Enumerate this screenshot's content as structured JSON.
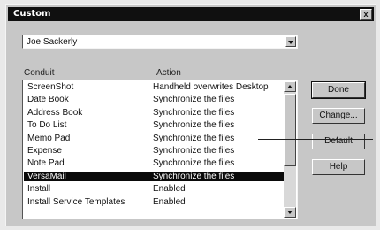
{
  "window": {
    "title": "Custom",
    "close_label": "x"
  },
  "user_select": {
    "value": "Joe Sackerly"
  },
  "columns": {
    "conduit": "Conduit",
    "action": "Action"
  },
  "list": {
    "rows": [
      {
        "conduit": "ScreenShot",
        "action": "Handheld overwrites Desktop"
      },
      {
        "conduit": "Date Book",
        "action": "Synchronize the files"
      },
      {
        "conduit": "Address Book",
        "action": "Synchronize the files"
      },
      {
        "conduit": "To Do List",
        "action": "Synchronize the files"
      },
      {
        "conduit": "Memo Pad",
        "action": "Synchronize the files"
      },
      {
        "conduit": "Expense",
        "action": "Synchronize the files"
      },
      {
        "conduit": "Note Pad",
        "action": "Synchronize the files"
      },
      {
        "conduit": "VersaMail",
        "action": "Synchronize the files",
        "selected": true
      },
      {
        "conduit": "Install",
        "action": "Enabled"
      },
      {
        "conduit": "Install Service Templates",
        "action": "Enabled"
      }
    ]
  },
  "buttons": {
    "done": "Done",
    "change": "Change...",
    "default": "Default",
    "help": "Help"
  }
}
